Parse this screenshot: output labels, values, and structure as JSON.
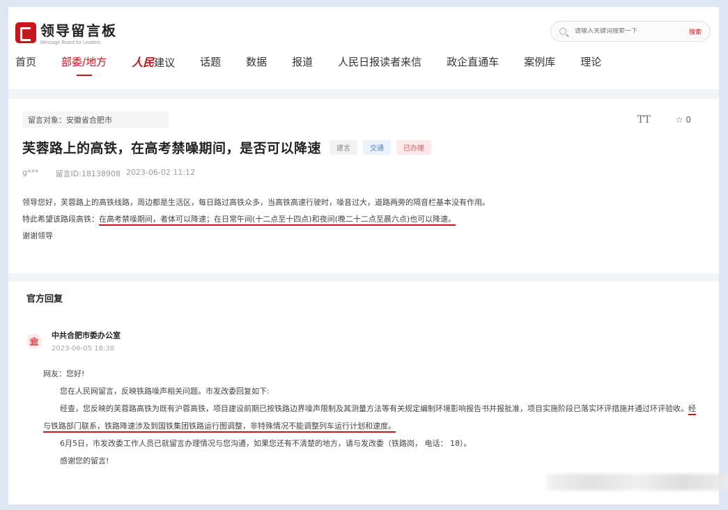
{
  "header": {
    "logo_title": "领导留言板",
    "logo_sub": "Message Board for Leaders",
    "search_placeholder": "请输入关键词搜索一下",
    "search_button": "搜索"
  },
  "nav": {
    "items": [
      "首页",
      "部委/地方",
      "人民",
      "建议",
      "话题",
      "数据",
      "报道",
      "人民日报读者来信",
      "政企直通车",
      "案例库",
      "理论"
    ]
  },
  "message": {
    "target": "留言对象：安徽省合肥市",
    "tools": {
      "font_size": "TT",
      "favorite": "☆ 0"
    },
    "title": "芙蓉路上的高铁，在高考禁噪期间，是否可以降速",
    "tags": [
      "建言",
      "交通",
      "已办理"
    ],
    "author": "g***",
    "id": "留言ID:18138908",
    "datetime": "2023-06-02 11:12",
    "para1": "领导您好，芙蓉路上的高铁线路，周边都是生活区，每日路过高铁众多，当高铁高速行驶时，噪音过大，道路两旁的隔音栏基本没有作用。",
    "para2_prefix": "特此希望该路段高铁：",
    "para2_highlight": "在高考禁噪期间，者体可以降速；在日常午间(十二点至十四点)和夜间(晚二十二点至晨六点)也可以降速。",
    "para3": "谢谢领导"
  },
  "reply": {
    "heading": "官方回复",
    "org": "中共合肥市委办公室",
    "date": "2023-06-05 18:38",
    "greeting": "网友：您好!",
    "p1": "您在人民网留言，反映铁路噪声相关问题。市发改委回复如下:",
    "p2": "经查，您反映的芙蓉路高铁为既有沪蓉高铁，项目建设前期已按铁路边界噪声限制及其测量方法等有关规定编制环境影响报告书并报批准，项目实施阶段已落实环评措施并通过环评验收。",
    "p2_highlight": "经与铁路部门联系，铁路降速涉及到国铁集团铁路运行图调整，非特殊情况不能调整列车运行计划和速度。",
    "p3": "6月5日，市发改委工作人员已就留言办理情况与您沟通，如果您还有不清楚的地方，请与发改委（铁路岗，     电话：       18）。",
    "p4": "感谢您的留言!"
  }
}
